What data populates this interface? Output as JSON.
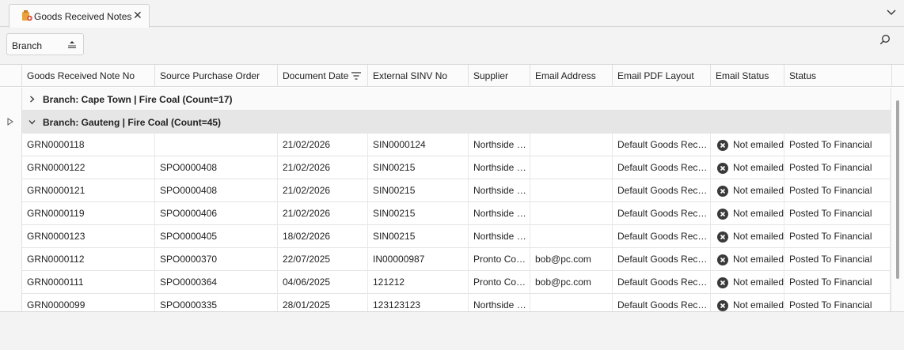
{
  "tab": {
    "title": "Goods Received Notes",
    "icon": "document-add-icon",
    "close": "✕"
  },
  "toolbar": {
    "group_by_label": "Branch"
  },
  "columns": [
    "Goods Received Note No",
    "Source Purchase Order",
    "Document Date",
    "External SINV No",
    "Supplier",
    "Email Address",
    "Email PDF Layout",
    "Email Status",
    "Status"
  ],
  "groups": [
    {
      "label": "Branch: Cape Town | Fire Coal (Count=17)",
      "expanded": false
    },
    {
      "label": "Branch: Gauteng | Fire Coal (Count=45)",
      "expanded": true
    }
  ],
  "rows": [
    [
      "GRN0000118",
      "",
      "21/02/2026",
      "SIN0000124",
      "Northside Coal Suppliers",
      "",
      "Default Goods Received Note",
      "Not emailed",
      "Posted To Financial"
    ],
    [
      "GRN0000122",
      "SPO0000408",
      "21/02/2026",
      "SIN00215",
      "Northside Coal Suppliers",
      "",
      "Default Goods Received Note",
      "Not emailed",
      "Posted To Financial"
    ],
    [
      "GRN0000121",
      "SPO0000408",
      "21/02/2026",
      "SIN00215",
      "Northside Coal Suppliers",
      "",
      "Default Goods Received Note",
      "Not emailed",
      "Posted To Financial"
    ],
    [
      "GRN0000119",
      "SPO0000406",
      "21/02/2026",
      "SIN00215",
      "Northside Coal Suppliers",
      "",
      "Default Goods Received Note",
      "Not emailed",
      "Posted To Financial"
    ],
    [
      "GRN0000123",
      "SPO0000405",
      "18/02/2026",
      "SIN00215",
      "Northside Coal Suppliers",
      "",
      "Default Goods Received Note",
      "Not emailed",
      "Posted To Financial"
    ],
    [
      "GRN0000112",
      "SPO0000370",
      "22/07/2025",
      "IN00000987",
      "Pronto Construction",
      "bob@pc.com",
      "Default Goods Received Note",
      "Not emailed",
      "Posted To Financial"
    ],
    [
      "GRN0000111",
      "SPO0000364",
      "04/06/2025",
      "121212",
      "Pronto Construction",
      "bob@pc.com",
      "Default Goods Received Note",
      "Not emailed",
      "Posted To Financial"
    ],
    [
      "GRN0000099",
      "SPO0000335",
      "28/01/2025",
      "123123123",
      "Northside Coal Suppliers",
      "",
      "Default Goods Received Note",
      "Not emailed",
      "Posted To Financial"
    ]
  ],
  "colors": {
    "email_status_icon": "#3a3a3a",
    "tab_icon": "#e8a33a"
  }
}
